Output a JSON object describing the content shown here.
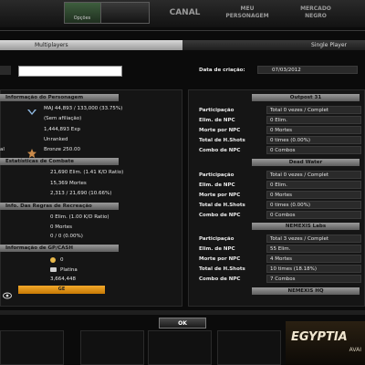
{
  "nav": {
    "tab1_caption": "Opções",
    "items": [
      {
        "label": "CANAL"
      },
      {
        "label": "MEU\nPERSONAGEM"
      },
      {
        "label": "MERCADO\nNEGRO"
      }
    ]
  },
  "header": {
    "left_title": "Multiplayers",
    "right_title": "Single Player"
  },
  "search": {
    "value": ""
  },
  "creation": {
    "label": "Data de criação:",
    "value": "07/03/2012"
  },
  "character": {
    "title": "Informação do Personagem",
    "level_line": "MAJ  44,893 / 133,000 (33.75%)",
    "affiliation": "(Sem afiliação)",
    "exp": "1,444,893 Exp",
    "rank": "Unranked",
    "cut_label": "al",
    "tier": "Bronze 250.00"
  },
  "combat": {
    "title": "Estatísticas de Combate",
    "lines": [
      "21,690 Elim. (1.41 K/D Ratio)",
      "15,369 Mortes",
      "2,313 / 21,690 (10.66%)"
    ]
  },
  "recreation": {
    "title": "Info. Das Regras de Recreação",
    "lines": [
      "0 Elim. (1.00 K/D Ratio)",
      "0 Mortes",
      "0 / 0 (0.00%)"
    ]
  },
  "gp": {
    "title": "Informação de GP/CASH",
    "line1": "0",
    "line2": "Platina",
    "line3": "3,664,448",
    "button": "GE"
  },
  "outposts": [
    {
      "title": "Outpost 31",
      "rows": [
        {
          "label": "Participação",
          "value": "Total 0 vezes / Complet"
        },
        {
          "label": "Elim. de NPC",
          "value": "0 Elim."
        },
        {
          "label": "Morte por NPC",
          "value": "0 Mortes"
        },
        {
          "label": "Total de H.Shots",
          "value": "0 times (0.00%)"
        },
        {
          "label": "Combo de NPC",
          "value": "0 Combos"
        }
      ]
    },
    {
      "title": "Dead Water",
      "rows": [
        {
          "label": "Participação",
          "value": "Total 0 vezes / Complet"
        },
        {
          "label": "Elim. de NPC",
          "value": "0 Elim."
        },
        {
          "label": "Morte por NPC",
          "value": "0 Mortes"
        },
        {
          "label": "Total de H.Shots",
          "value": "0 times (0.00%)"
        },
        {
          "label": "Combo de NPC",
          "value": "0 Combos"
        }
      ]
    },
    {
      "title": "NEMEXIS Labs",
      "rows": [
        {
          "label": "Participação",
          "value": "Total 3 vezes / Complet"
        },
        {
          "label": "Elim. de NPC",
          "value": "55 Elim."
        },
        {
          "label": "Morte por NPC",
          "value": "4 Mortes"
        },
        {
          "label": "Total de H.Shots",
          "value": "10 times (18.18%)"
        },
        {
          "label": "Combo de NPC",
          "value": "7 Combos"
        }
      ]
    },
    {
      "title": "NEMEXIS HQ",
      "rows": []
    }
  ],
  "ok_label": "OK",
  "banner": {
    "line1": "EGYPTIA",
    "line2": "AVAI"
  },
  "colors": {
    "accent": "#f2a92b",
    "header_light": "#d8d8d8"
  }
}
